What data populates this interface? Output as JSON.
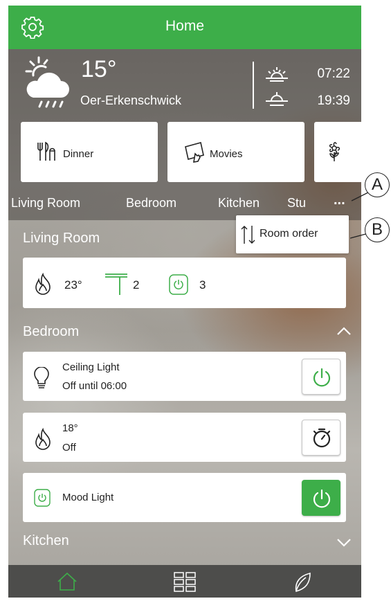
{
  "header": {
    "title": "Home"
  },
  "weather": {
    "temperature": "15°",
    "location": "Oer-Erkenschwick",
    "sunrise": "07:22",
    "sunset": "19:39"
  },
  "scenes": [
    {
      "label": "Dinner",
      "icon": "cutlery-icon"
    },
    {
      "label": "Movies",
      "icon": "tablet-touch-icon"
    },
    {
      "label": "",
      "icon": "flower-icon"
    }
  ],
  "room_tabs": [
    "Living Room",
    "Bedroom",
    "Kitchen",
    "Stu"
  ],
  "more_menu": {
    "label": "...",
    "items": [
      "Room order"
    ]
  },
  "sections": {
    "living_room": {
      "title": "Living Room",
      "summary": {
        "temperature": "23°",
        "shutters": "2",
        "switches": "3"
      }
    },
    "bedroom": {
      "title": "Bedroom",
      "devices": [
        {
          "name": "Ceiling Light",
          "status": "Off until 06:00",
          "icon": "light-bulb-icon",
          "action": "power-icon"
        },
        {
          "name": "18°",
          "status": "Off",
          "icon": "flame-icon",
          "action": "timer-icon"
        },
        {
          "name": "Mood Light",
          "status": "",
          "icon": "socket-icon",
          "action": "power-icon",
          "on": true
        }
      ]
    },
    "kitchen": {
      "title": "Kitchen"
    }
  },
  "bottom_nav": [
    {
      "name": "home-icon",
      "active": true
    },
    {
      "name": "grid-icon",
      "active": false
    },
    {
      "name": "leaf-icon",
      "active": false
    }
  ],
  "callouts": [
    "A",
    "B"
  ],
  "colors": {
    "brand_green": "#3dae49",
    "nav_bg": "#4d4d4b"
  }
}
